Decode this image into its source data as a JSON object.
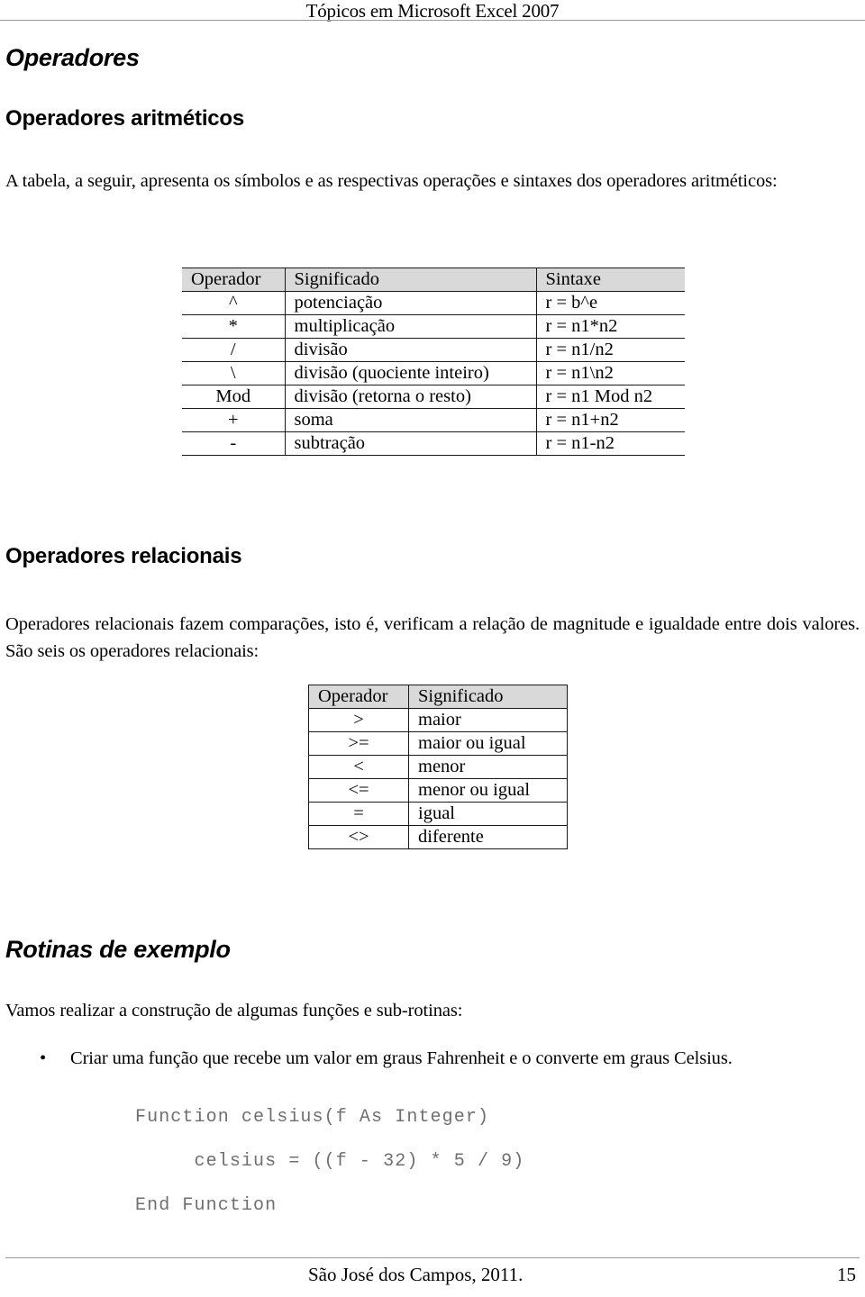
{
  "header": {
    "title": "Tópicos em Microsoft Excel 2007"
  },
  "document": {
    "title": "Operadores"
  },
  "sections": {
    "arithmetic": {
      "heading": "Operadores aritméticos",
      "intro": "A tabela, a seguir, apresenta os símbolos e as respectivas operações e sintaxes dos operadores aritméticos:",
      "table": {
        "columns": [
          "Operador",
          "Significado",
          "Sintaxe"
        ],
        "rows": [
          [
            "^",
            "potenciação",
            "r = b^e"
          ],
          [
            "*",
            "multiplicação",
            "r = n1*n2"
          ],
          [
            "/",
            "divisão",
            "r = n1/n2"
          ],
          [
            "\\",
            "divisão (quociente inteiro)",
            "r = n1\\n2"
          ],
          [
            "Mod",
            "divisão (retorna o resto)",
            "r = n1 Mod n2"
          ],
          [
            "+",
            "soma",
            "r = n1+n2"
          ],
          [
            "-",
            "subtração",
            "r = n1-n2"
          ]
        ]
      }
    },
    "relational": {
      "heading": "Operadores relacionais",
      "intro": "Operadores relacionais fazem comparações, isto é, verificam a relação de magnitude e igualdade entre dois valores. São seis os operadores relacionais:",
      "table": {
        "columns": [
          "Operador",
          "Significado"
        ],
        "rows": [
          [
            ">",
            "maior"
          ],
          [
            ">=",
            "maior ou igual"
          ],
          [
            "<",
            "menor"
          ],
          [
            "<=",
            "menor ou igual"
          ],
          [
            "=",
            "igual"
          ],
          [
            "<>",
            "diferente"
          ]
        ]
      }
    },
    "routines": {
      "heading": "Rotinas de exemplo",
      "intro": "Vamos realizar a construção de algumas funções e sub-rotinas:",
      "bullet_mark": "•",
      "items": [
        "Criar uma função que recebe um valor em graus Fahrenheit e o converte em graus Celsius."
      ],
      "code": "Function celsius(f As Integer)\n     celsius = ((f - 32) * 5 / 9)\nEnd Function"
    }
  },
  "footer": {
    "location": "São José dos Campos, 2011.",
    "page_number": "15"
  },
  "colors": {
    "table_header_fill": "#d9d9d9",
    "rule": "#9c9c9c",
    "code_text": "#6f6f6f",
    "text": "#000000"
  }
}
